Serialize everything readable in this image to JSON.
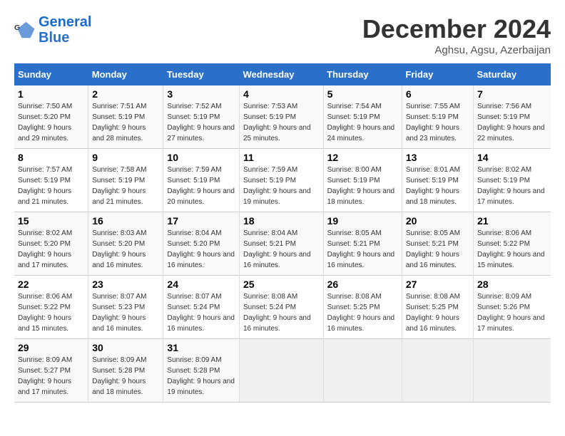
{
  "logo": {
    "line1": "General",
    "line2": "Blue"
  },
  "title": "December 2024",
  "subtitle": "Aghsu, Agsu, Azerbaijan",
  "days_of_week": [
    "Sunday",
    "Monday",
    "Tuesday",
    "Wednesday",
    "Thursday",
    "Friday",
    "Saturday"
  ],
  "weeks": [
    [
      {
        "day": 1,
        "sunrise": "7:50 AM",
        "sunset": "5:20 PM",
        "daylight": "9 hours and 29 minutes."
      },
      {
        "day": 2,
        "sunrise": "7:51 AM",
        "sunset": "5:19 PM",
        "daylight": "9 hours and 28 minutes."
      },
      {
        "day": 3,
        "sunrise": "7:52 AM",
        "sunset": "5:19 PM",
        "daylight": "9 hours and 27 minutes."
      },
      {
        "day": 4,
        "sunrise": "7:53 AM",
        "sunset": "5:19 PM",
        "daylight": "9 hours and 25 minutes."
      },
      {
        "day": 5,
        "sunrise": "7:54 AM",
        "sunset": "5:19 PM",
        "daylight": "9 hours and 24 minutes."
      },
      {
        "day": 6,
        "sunrise": "7:55 AM",
        "sunset": "5:19 PM",
        "daylight": "9 hours and 23 minutes."
      },
      {
        "day": 7,
        "sunrise": "7:56 AM",
        "sunset": "5:19 PM",
        "daylight": "9 hours and 22 minutes."
      }
    ],
    [
      {
        "day": 8,
        "sunrise": "7:57 AM",
        "sunset": "5:19 PM",
        "daylight": "9 hours and 21 minutes."
      },
      {
        "day": 9,
        "sunrise": "7:58 AM",
        "sunset": "5:19 PM",
        "daylight": "9 hours and 21 minutes."
      },
      {
        "day": 10,
        "sunrise": "7:59 AM",
        "sunset": "5:19 PM",
        "daylight": "9 hours and 20 minutes."
      },
      {
        "day": 11,
        "sunrise": "7:59 AM",
        "sunset": "5:19 PM",
        "daylight": "9 hours and 19 minutes."
      },
      {
        "day": 12,
        "sunrise": "8:00 AM",
        "sunset": "5:19 PM",
        "daylight": "9 hours and 18 minutes."
      },
      {
        "day": 13,
        "sunrise": "8:01 AM",
        "sunset": "5:19 PM",
        "daylight": "9 hours and 18 minutes."
      },
      {
        "day": 14,
        "sunrise": "8:02 AM",
        "sunset": "5:19 PM",
        "daylight": "9 hours and 17 minutes."
      }
    ],
    [
      {
        "day": 15,
        "sunrise": "8:02 AM",
        "sunset": "5:20 PM",
        "daylight": "9 hours and 17 minutes."
      },
      {
        "day": 16,
        "sunrise": "8:03 AM",
        "sunset": "5:20 PM",
        "daylight": "9 hours and 16 minutes."
      },
      {
        "day": 17,
        "sunrise": "8:04 AM",
        "sunset": "5:20 PM",
        "daylight": "9 hours and 16 minutes."
      },
      {
        "day": 18,
        "sunrise": "8:04 AM",
        "sunset": "5:21 PM",
        "daylight": "9 hours and 16 minutes."
      },
      {
        "day": 19,
        "sunrise": "8:05 AM",
        "sunset": "5:21 PM",
        "daylight": "9 hours and 16 minutes."
      },
      {
        "day": 20,
        "sunrise": "8:05 AM",
        "sunset": "5:21 PM",
        "daylight": "9 hours and 16 minutes."
      },
      {
        "day": 21,
        "sunrise": "8:06 AM",
        "sunset": "5:22 PM",
        "daylight": "9 hours and 15 minutes."
      }
    ],
    [
      {
        "day": 22,
        "sunrise": "8:06 AM",
        "sunset": "5:22 PM",
        "daylight": "9 hours and 15 minutes."
      },
      {
        "day": 23,
        "sunrise": "8:07 AM",
        "sunset": "5:23 PM",
        "daylight": "9 hours and 16 minutes."
      },
      {
        "day": 24,
        "sunrise": "8:07 AM",
        "sunset": "5:24 PM",
        "daylight": "9 hours and 16 minutes."
      },
      {
        "day": 25,
        "sunrise": "8:08 AM",
        "sunset": "5:24 PM",
        "daylight": "9 hours and 16 minutes."
      },
      {
        "day": 26,
        "sunrise": "8:08 AM",
        "sunset": "5:25 PM",
        "daylight": "9 hours and 16 minutes."
      },
      {
        "day": 27,
        "sunrise": "8:08 AM",
        "sunset": "5:25 PM",
        "daylight": "9 hours and 16 minutes."
      },
      {
        "day": 28,
        "sunrise": "8:09 AM",
        "sunset": "5:26 PM",
        "daylight": "9 hours and 17 minutes."
      }
    ],
    [
      {
        "day": 29,
        "sunrise": "8:09 AM",
        "sunset": "5:27 PM",
        "daylight": "9 hours and 17 minutes."
      },
      {
        "day": 30,
        "sunrise": "8:09 AM",
        "sunset": "5:28 PM",
        "daylight": "9 hours and 18 minutes."
      },
      {
        "day": 31,
        "sunrise": "8:09 AM",
        "sunset": "5:28 PM",
        "daylight": "9 hours and 19 minutes."
      },
      null,
      null,
      null,
      null
    ]
  ]
}
